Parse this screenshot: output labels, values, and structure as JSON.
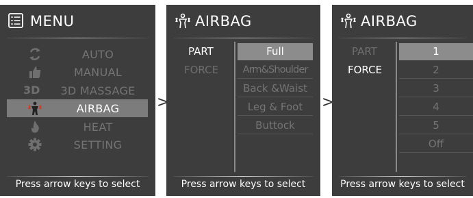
{
  "colors": {
    "panel_bg": "#3d3d3d",
    "highlight": "#7c7c7c",
    "dim_text": "#747474",
    "text": "#ffffff"
  },
  "panels": [
    {
      "title": "MENU",
      "icon": "menu-list-icon",
      "items": [
        {
          "label": "AUTO",
          "icon": "refresh-icon",
          "selected": false
        },
        {
          "label": "MANUAL",
          "icon": "thumbs-up-icon",
          "selected": false
        },
        {
          "label": "3D MASSAGE",
          "icon": "3d-icon",
          "icon_text": "3D",
          "selected": false
        },
        {
          "label": "AIRBAG",
          "icon": "airbag-person-icon",
          "selected": true
        },
        {
          "label": "HEAT",
          "icon": "flame-icon",
          "selected": false
        },
        {
          "label": "SETTING",
          "icon": "gear-icon",
          "selected": false
        }
      ],
      "footer": "Press arrow keys to select"
    },
    {
      "title": "AIRBAG",
      "icon": "airbag-person-icon",
      "labels": [
        {
          "text": "PART",
          "active": true
        },
        {
          "text": "FORCE",
          "active": false
        }
      ],
      "options": [
        {
          "text": "Full",
          "selected": true
        },
        {
          "text": "Arm&Shoulder",
          "selected": false
        },
        {
          "text": "Back &Waist",
          "selected": false
        },
        {
          "text": "Leg & Foot",
          "selected": false
        },
        {
          "text": "Buttock",
          "selected": false
        }
      ],
      "footer": "Press arrow keys to select"
    },
    {
      "title": "AIRBAG",
      "icon": "airbag-person-icon",
      "labels": [
        {
          "text": "PART",
          "active": false
        },
        {
          "text": "FORCE",
          "active": true
        }
      ],
      "options": [
        {
          "text": "1",
          "selected": true
        },
        {
          "text": "2",
          "selected": false
        },
        {
          "text": "3",
          "selected": false
        },
        {
          "text": "4",
          "selected": false
        },
        {
          "text": "5",
          "selected": false
        },
        {
          "text": "Off",
          "selected": false
        }
      ],
      "footer": "Press arrow keys to select"
    }
  ],
  "arrows": [
    {
      "glyph": ">",
      "icon": "chevron-right-icon"
    },
    {
      "glyph": ">",
      "icon": "chevron-right-icon"
    }
  ]
}
